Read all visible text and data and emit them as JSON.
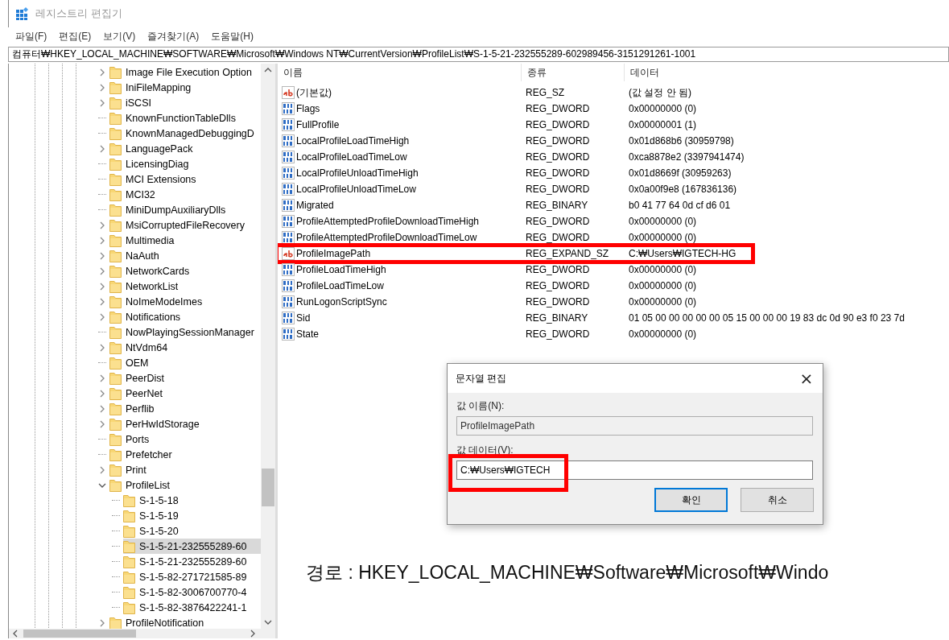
{
  "window": {
    "title": "레지스트리 편집기"
  },
  "menu": [
    "파일(F)",
    "편집(E)",
    "보기(V)",
    "즐겨찾기(A)",
    "도움말(H)"
  ],
  "address": "컴퓨터₩HKEY_LOCAL_MACHINE₩SOFTWARE₩Microsoft₩Windows NT₩CurrentVersion₩ProfileList₩S-1-5-21-232555289-602989456-3151291261-1001",
  "tree": [
    {
      "label": "Image File Execution Option",
      "kind": "branch",
      "expanded": false,
      "selected": false
    },
    {
      "label": "IniFileMapping",
      "kind": "branch",
      "expanded": false,
      "selected": false
    },
    {
      "label": "iSCSI",
      "kind": "branch",
      "expanded": false,
      "selected": false
    },
    {
      "label": "KnownFunctionTableDlls",
      "kind": "leaf",
      "selected": false
    },
    {
      "label": "KnownManagedDebuggingD",
      "kind": "leaf",
      "selected": false
    },
    {
      "label": "LanguagePack",
      "kind": "branch",
      "expanded": false,
      "selected": false
    },
    {
      "label": "LicensingDiag",
      "kind": "leaf",
      "selected": false
    },
    {
      "label": "MCI Extensions",
      "kind": "leaf",
      "selected": false
    },
    {
      "label": "MCI32",
      "kind": "leaf",
      "selected": false
    },
    {
      "label": "MiniDumpAuxiliaryDlls",
      "kind": "leaf",
      "selected": false
    },
    {
      "label": "MsiCorruptedFileRecovery",
      "kind": "branch",
      "expanded": false,
      "selected": false
    },
    {
      "label": "Multimedia",
      "kind": "branch",
      "expanded": false,
      "selected": false
    },
    {
      "label": "NaAuth",
      "kind": "branch",
      "expanded": false,
      "selected": false
    },
    {
      "label": "NetworkCards",
      "kind": "branch",
      "expanded": false,
      "selected": false
    },
    {
      "label": "NetworkList",
      "kind": "branch",
      "expanded": false,
      "selected": false
    },
    {
      "label": "NoImeModeImes",
      "kind": "branch",
      "expanded": false,
      "selected": false
    },
    {
      "label": "Notifications",
      "kind": "branch",
      "expanded": false,
      "selected": false
    },
    {
      "label": "NowPlayingSessionManager",
      "kind": "leaf",
      "selected": false
    },
    {
      "label": "NtVdm64",
      "kind": "branch",
      "expanded": false,
      "selected": false
    },
    {
      "label": "OEM",
      "kind": "leaf",
      "selected": false
    },
    {
      "label": "PeerDist",
      "kind": "branch",
      "expanded": false,
      "selected": false
    },
    {
      "label": "PeerNet",
      "kind": "branch",
      "expanded": false,
      "selected": false
    },
    {
      "label": "Perflib",
      "kind": "branch",
      "expanded": false,
      "selected": false
    },
    {
      "label": "PerHwIdStorage",
      "kind": "branch",
      "expanded": false,
      "selected": false
    },
    {
      "label": "Ports",
      "kind": "leaf",
      "selected": false
    },
    {
      "label": "Prefetcher",
      "kind": "leaf",
      "selected": false
    },
    {
      "label": "Print",
      "kind": "branch",
      "expanded": false,
      "selected": false
    },
    {
      "label": "ProfileList",
      "kind": "branch",
      "expanded": true,
      "selected": false,
      "children": [
        {
          "label": "S-1-5-18",
          "kind": "leaf",
          "selected": false
        },
        {
          "label": "S-1-5-19",
          "kind": "leaf",
          "selected": false
        },
        {
          "label": "S-1-5-20",
          "kind": "leaf",
          "selected": false
        },
        {
          "label": "S-1-5-21-232555289-60",
          "kind": "leaf",
          "selected": true
        },
        {
          "label": "S-1-5-21-232555289-60",
          "kind": "leaf",
          "selected": false
        },
        {
          "label": "S-1-5-82-271721585-89",
          "kind": "leaf",
          "selected": false
        },
        {
          "label": "S-1-5-82-3006700770-4",
          "kind": "leaf",
          "selected": false
        },
        {
          "label": "S-1-5-82-3876422241-1",
          "kind": "leaf",
          "selected": false
        }
      ]
    },
    {
      "label": "ProfileNotification",
      "kind": "branch",
      "expanded": false,
      "selected": false
    }
  ],
  "values": {
    "columns": [
      "이름",
      "종류",
      "데이터"
    ],
    "rows": [
      {
        "kind": "string",
        "name": "(기본값)",
        "type": "REG_SZ",
        "data": "(값 설정 안 됨)",
        "highlighted": false
      },
      {
        "kind": "binary",
        "name": "Flags",
        "type": "REG_DWORD",
        "data": "0x00000000 (0)",
        "highlighted": false
      },
      {
        "kind": "binary",
        "name": "FullProfile",
        "type": "REG_DWORD",
        "data": "0x00000001 (1)",
        "highlighted": false
      },
      {
        "kind": "binary",
        "name": "LocalProfileLoadTimeHigh",
        "type": "REG_DWORD",
        "data": "0x01d868b6 (30959798)",
        "highlighted": false
      },
      {
        "kind": "binary",
        "name": "LocalProfileLoadTimeLow",
        "type": "REG_DWORD",
        "data": "0xca8878e2 (3397941474)",
        "highlighted": false
      },
      {
        "kind": "binary",
        "name": "LocalProfileUnloadTimeHigh",
        "type": "REG_DWORD",
        "data": "0x01d8669f (30959263)",
        "highlighted": false
      },
      {
        "kind": "binary",
        "name": "LocalProfileUnloadTimeLow",
        "type": "REG_DWORD",
        "data": "0x0a00f9e8 (167836136)",
        "highlighted": false
      },
      {
        "kind": "binary",
        "name": "Migrated",
        "type": "REG_BINARY",
        "data": "b0 41 77 64 0d cf d6 01",
        "highlighted": false
      },
      {
        "kind": "binary",
        "name": "ProfileAttemptedProfileDownloadTimeHigh",
        "type": "REG_DWORD",
        "data": "0x00000000 (0)",
        "highlighted": false
      },
      {
        "kind": "binary",
        "name": "ProfileAttemptedProfileDownloadTimeLow",
        "type": "REG_DWORD",
        "data": "0x00000000 (0)",
        "highlighted": false
      },
      {
        "kind": "string",
        "name": "ProfileImagePath",
        "type": "REG_EXPAND_SZ",
        "data": "C:₩Users₩IGTECH-HG",
        "highlighted": true
      },
      {
        "kind": "binary",
        "name": "ProfileLoadTimeHigh",
        "type": "REG_DWORD",
        "data": "0x00000000 (0)",
        "highlighted": false
      },
      {
        "kind": "binary",
        "name": "ProfileLoadTimeLow",
        "type": "REG_DWORD",
        "data": "0x00000000 (0)",
        "highlighted": false
      },
      {
        "kind": "binary",
        "name": "RunLogonScriptSync",
        "type": "REG_DWORD",
        "data": "0x00000000 (0)",
        "highlighted": false
      },
      {
        "kind": "binary",
        "name": "Sid",
        "type": "REG_BINARY",
        "data": "01 05 00 00 00 00 00 05 15 00 00 00 19 83 dc 0d 90 e3 f0 23 7d",
        "highlighted": false
      },
      {
        "kind": "binary",
        "name": "State",
        "type": "REG_DWORD",
        "data": "0x00000000 (0)",
        "highlighted": false
      }
    ]
  },
  "dialog": {
    "title": "문자열 편집",
    "close": "×",
    "name_label": "값 이름(N):",
    "name_value": "ProfileImagePath",
    "data_label": "값 데이터(V):",
    "data_value": "C:₩Users₩IGTECH",
    "data_highlighted": true,
    "buttons": [
      {
        "label": "확인",
        "default": true
      },
      {
        "label": "취소",
        "default": false
      }
    ]
  },
  "caption": "경로 : HKEY_LOCAL_MACHINE₩Software₩Microsoft₩Windo"
}
